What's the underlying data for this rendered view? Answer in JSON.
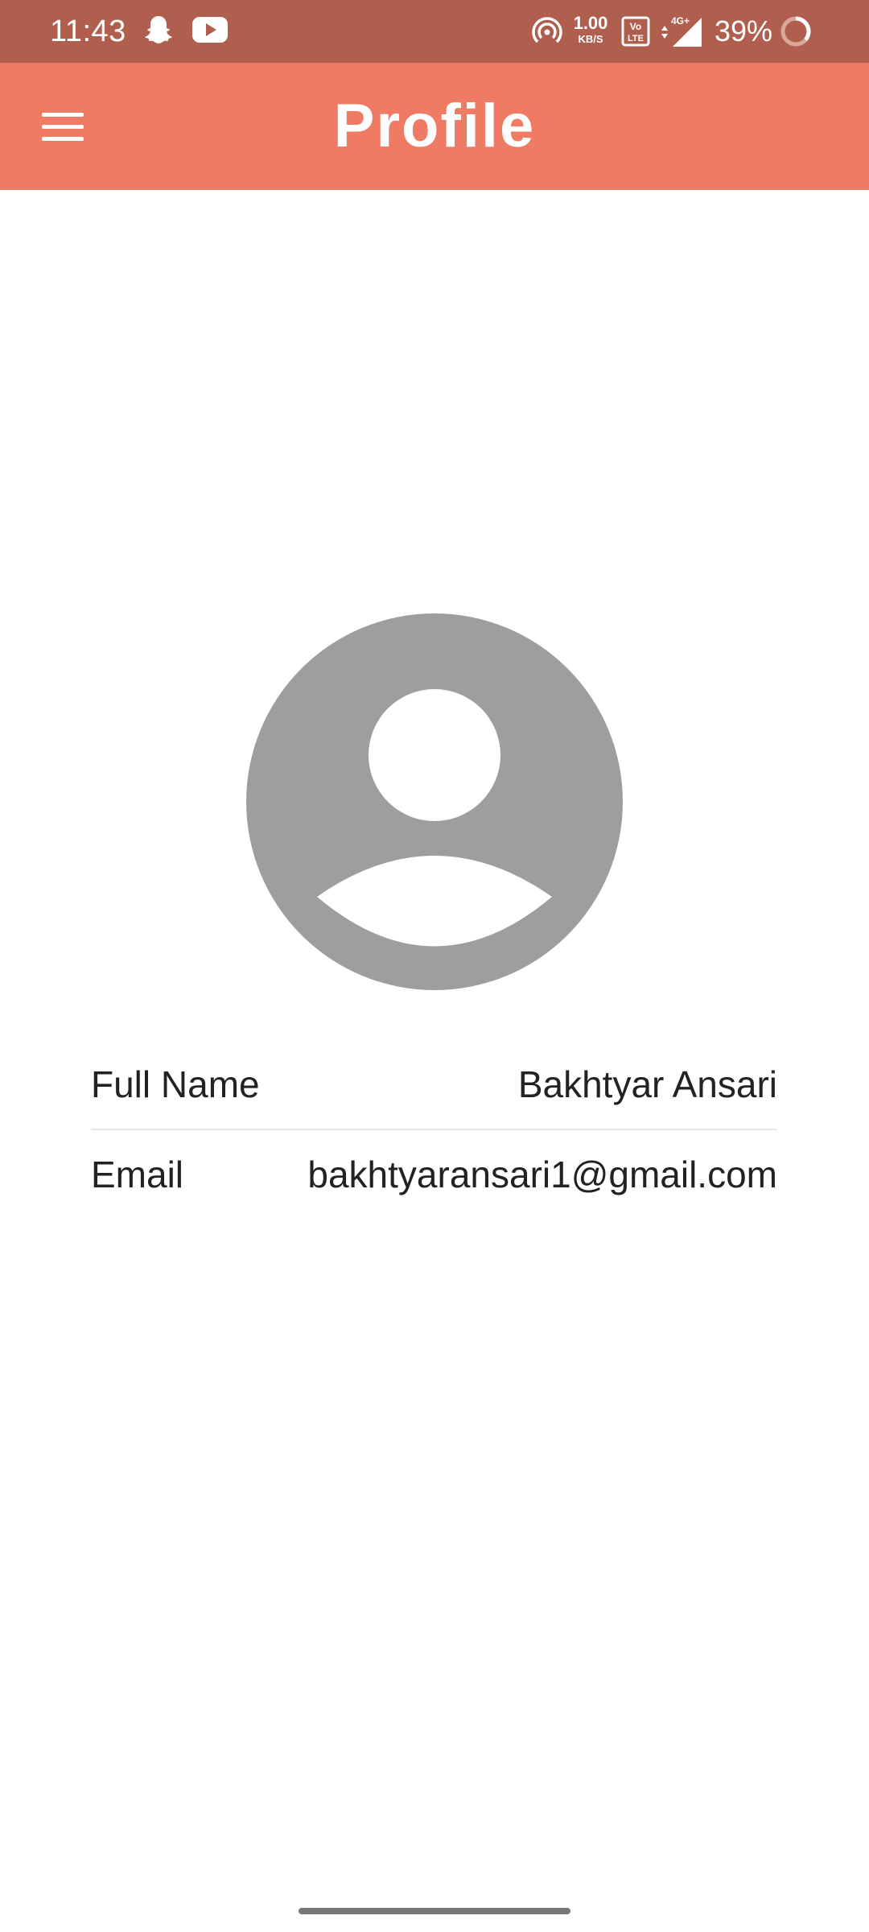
{
  "status_bar": {
    "time": "11:43",
    "network_speed_value": "1.00",
    "network_speed_unit": "KB/S",
    "battery_percent": "39%",
    "icons": [
      "snapchat-icon",
      "youtube-icon",
      "hotspot-icon",
      "volte-icon",
      "signal-4g-icon",
      "battery-ring-icon"
    ]
  },
  "app_bar": {
    "title": "Profile",
    "menu_icon": "hamburger-menu-icon",
    "background_color": "#EF7B65"
  },
  "profile": {
    "avatar_icon": "default-avatar-icon",
    "fields": [
      {
        "label": "Full Name",
        "value": "Bakhtyar Ansari"
      },
      {
        "label": "Email",
        "value": "bakhtyaransari1@gmail.com"
      }
    ]
  },
  "colors": {
    "status_bar": "#B05E4E",
    "app_bar": "#EF7B65",
    "avatar": "#9E9E9E"
  }
}
